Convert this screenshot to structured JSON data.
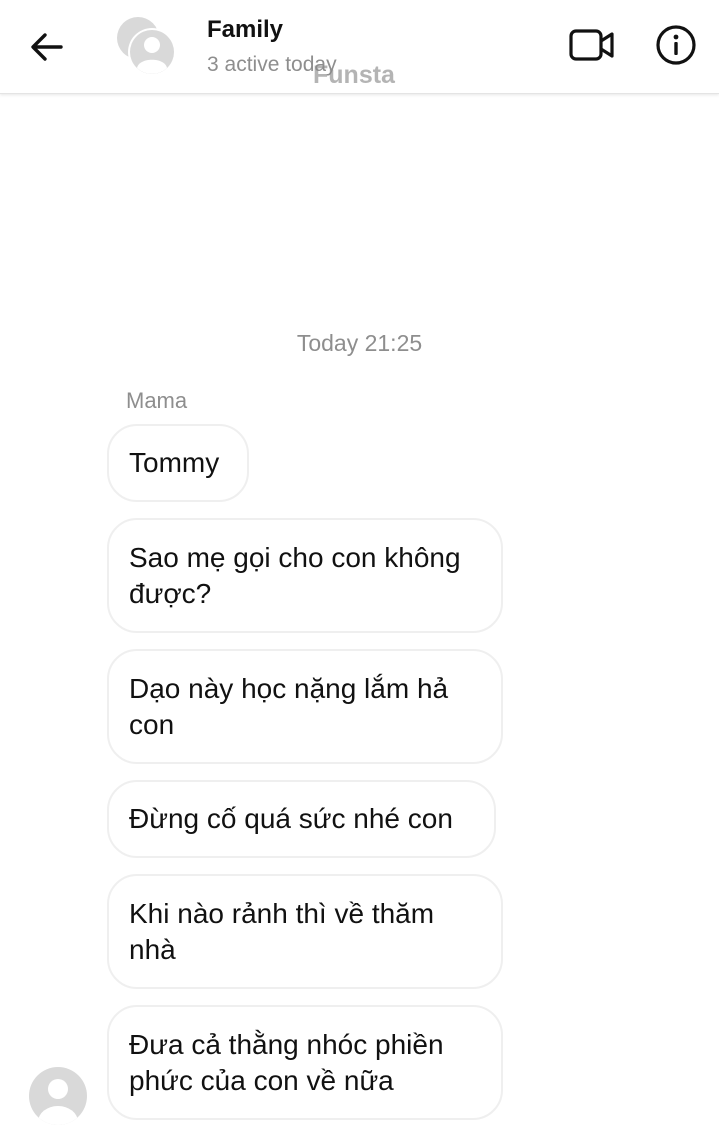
{
  "header": {
    "title": "Family",
    "status": "3 active today",
    "watermark": "Funsta",
    "back_icon": "arrow-left-icon",
    "video_icon": "video-camera-icon",
    "info_icon": "info-circle-icon"
  },
  "conversation": {
    "timestamp": "Today 21:25",
    "sender": "Mama",
    "messages": [
      "Tommy",
      "Sao mẹ gọi cho con không được?",
      "Dạo này học nặng lắm hả con",
      "Đừng cố quá sức nhé con",
      "Khi nào rảnh thì về thăm nhà",
      "Đưa cả thằng nhóc phiền phức của con về nữa"
    ]
  },
  "colors": {
    "secondary_text": "#8e8e8e",
    "bubble_border": "#efefef",
    "avatar_placeholder": "#d9d9d9"
  }
}
